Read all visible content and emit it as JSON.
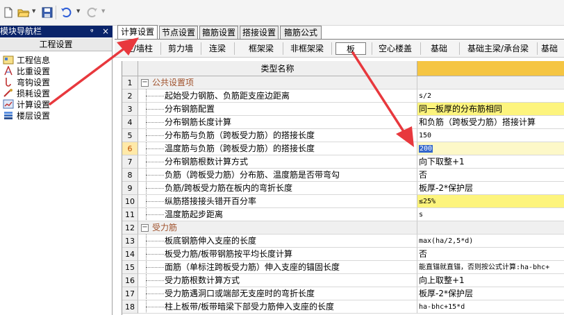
{
  "toolbar": {
    "icons": [
      "new-file-icon",
      "open-folder-icon",
      "save-icon",
      "undo-icon",
      "redo-icon",
      "more-icon"
    ]
  },
  "nav": {
    "title": "模块导航栏",
    "pin": "ᵠ",
    "close": "×",
    "section": "工程设置",
    "items": [
      {
        "label": "工程信息",
        "icon": "project-info-icon"
      },
      {
        "label": "比重设置",
        "icon": "ratio-icon"
      },
      {
        "label": "弯钩设置",
        "icon": "hook-icon"
      },
      {
        "label": "损耗设置",
        "icon": "loss-icon"
      },
      {
        "label": "计算设置",
        "icon": "calc-icon"
      },
      {
        "label": "楼层设置",
        "icon": "floor-icon"
      }
    ]
  },
  "tabs": [
    "计算设置",
    "节点设置",
    "箍筋设置",
    "搭接设置",
    "箍筋公式"
  ],
  "subbar": [
    "柱/墙柱",
    "剪力墙",
    "连梁",
    "框架梁",
    "非框架梁",
    "板",
    "空心楼盖",
    "基础",
    "基础主梁/承台梁",
    "基础"
  ],
  "grid": {
    "header_name": "类型名称",
    "rows": [
      {
        "n": "1",
        "name": "公共设置项",
        "value": "",
        "group": true
      },
      {
        "n": "2",
        "name": "起始受力钢筋、负筋距支座边距离",
        "value": "s/2"
      },
      {
        "n": "3",
        "name": "分布钢筋配置",
        "value": "同一板厚的分布筋相同"
      },
      {
        "n": "4",
        "name": "分布钢筋长度计算",
        "value": "和负筋（跨板受力筋）搭接计算"
      },
      {
        "n": "5",
        "name": "分布筋与负筋（跨板受力筋）的搭接长度",
        "value": "150"
      },
      {
        "n": "6",
        "name": "温度筋与负筋（跨板受力筋）的搭接长度",
        "value": "200"
      },
      {
        "n": "7",
        "name": "分布钢筋根数计算方式",
        "value": "向下取整+1"
      },
      {
        "n": "8",
        "name": "负筋（跨板受力筋）分布筋、温度筋是否带弯勾",
        "value": "否"
      },
      {
        "n": "9",
        "name": "负筋/跨板受力筋在板内的弯折长度",
        "value": "板厚-2*保护层"
      },
      {
        "n": "10",
        "name": "纵筋搭接接头错开百分率",
        "value": "≤25%"
      },
      {
        "n": "11",
        "name": "温度筋起步距离",
        "value": "s"
      },
      {
        "n": "12",
        "name": "受力筋",
        "value": "",
        "group": true
      },
      {
        "n": "13",
        "name": "板底钢筋伸入支座的长度",
        "value": "max(ha/2,5*d)"
      },
      {
        "n": "14",
        "name": "板受力筋/板带钢筋按平均长度计算",
        "value": "否"
      },
      {
        "n": "15",
        "name": "面筋（单标注跨板受力筋）伸入支座的锚固长度",
        "value": "能直锚就直锚，否则按公式计算:ha-bhc+"
      },
      {
        "n": "16",
        "name": "受力筋根数计算方式",
        "value": "向上取整+1"
      },
      {
        "n": "17",
        "name": "受力筋遇洞口或端部无支座时的弯折长度",
        "value": "板厚-2*保护层"
      },
      {
        "n": "18",
        "name": "柱上板带/板带暗梁下部受力筋伸入支座的长度",
        "value": "ha-bhc+15*d"
      }
    ]
  },
  "colors": {
    "arrow": "#e8383d",
    "nav_title_bg": "#0a246a",
    "header_accent": "#f5c542",
    "highlight_cell": "#fdf47d",
    "selection": "#3366cc"
  }
}
